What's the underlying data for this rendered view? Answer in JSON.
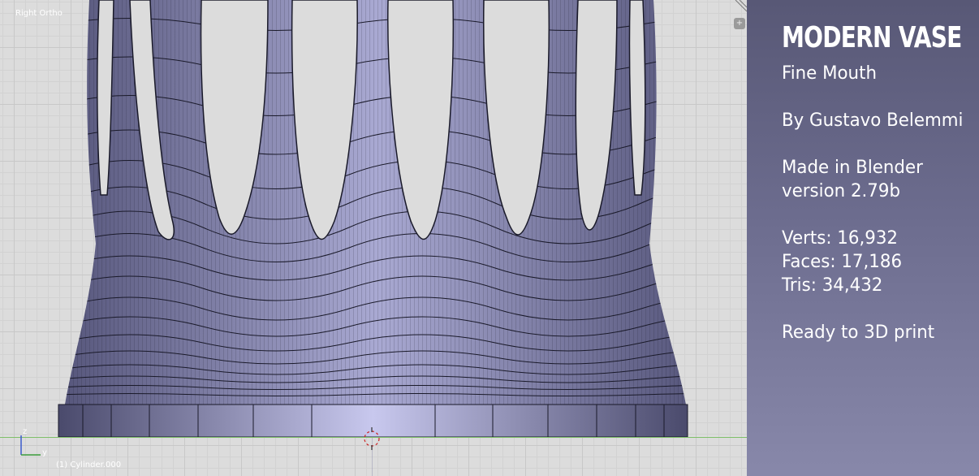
{
  "viewport": {
    "view_label": "Right Ortho",
    "object_label": "(1) Cylinder.000",
    "gizmo": {
      "z_label": "z",
      "y_label": "y"
    },
    "corner_widget_icon": "expand-icon"
  },
  "info_panel": {
    "title": "MODERN VASE",
    "subtitle": "Fine Mouth",
    "author": "By Gustavo Belemmi",
    "made_in": "Made in Blender",
    "version": "version 2.79b",
    "verts": "Verts: 16,932",
    "faces": "Faces: 17,186",
    "tris": "Tris: 34,432",
    "print_note": "Ready to 3D print"
  },
  "colors": {
    "panel_top": "#585876",
    "panel_bottom": "#8888aa",
    "mesh_fill": "#8c8cb0",
    "mesh_highlight": "#b9b9dc",
    "grid": "#dcdcdc",
    "ground_line": "#7fbf6a"
  }
}
